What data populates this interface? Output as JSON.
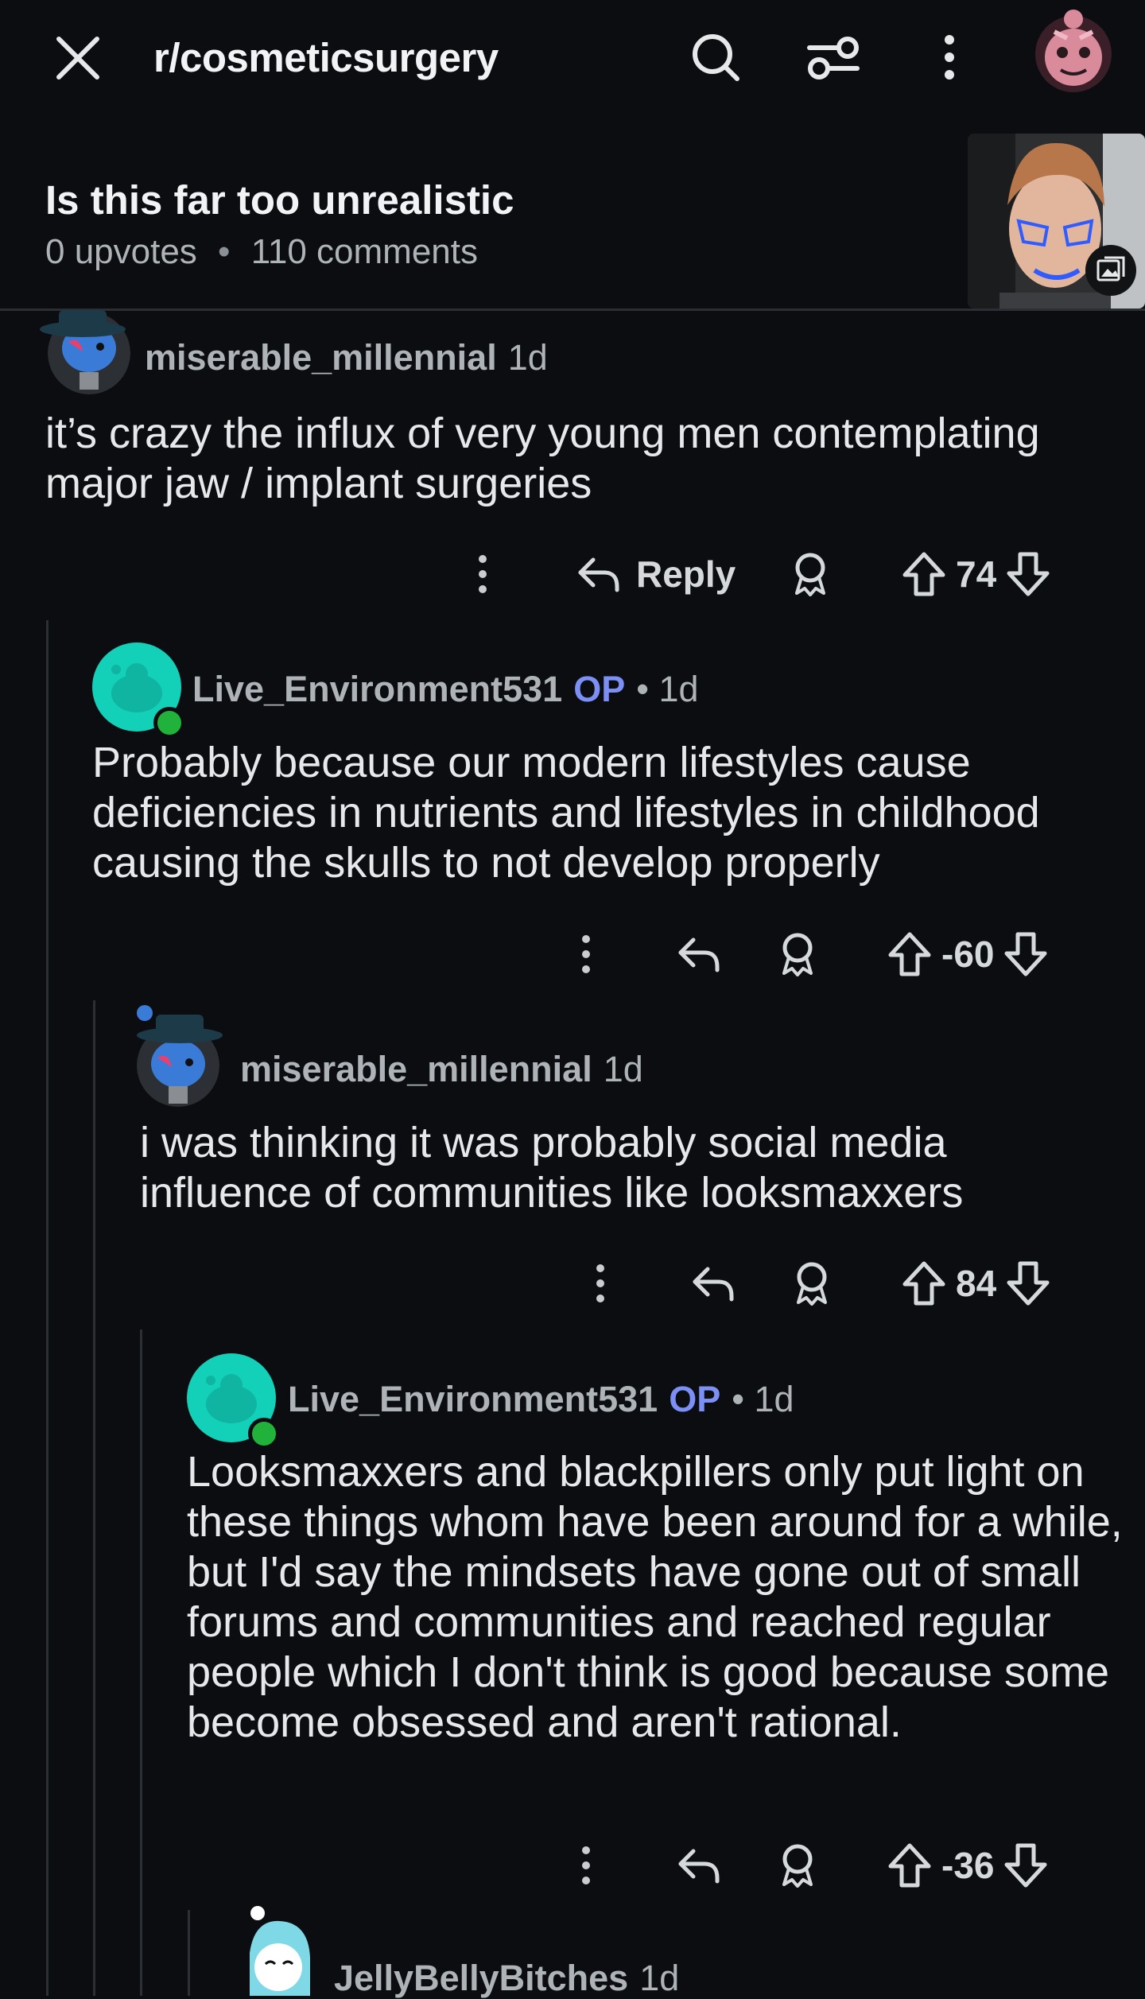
{
  "topbar": {
    "subreddit": "r/cosmeticsurgery"
  },
  "post": {
    "title": "Is this far too unrealistic",
    "upvotes": "0 upvotes",
    "separator": "•",
    "comments": "110 comments"
  },
  "comments": [
    {
      "username": "miserable_millennial",
      "age": "1d",
      "body": "it’s crazy the influx of very young men contemplating major jaw / implant surgeries",
      "reply_label": "Reply",
      "score": "74"
    },
    {
      "username": "Live_Environment531",
      "op": "OP",
      "age": "• 1d",
      "body": "Probably because our modern lifestyles cause deficiencies in nutrients and lifestyles in childhood causing the skulls to not develop properly",
      "score": "-60"
    },
    {
      "username": "miserable_millennial",
      "age": "1d",
      "body": "i was thinking it was probably social media influence of communities like looksmaxxers",
      "score": "84"
    },
    {
      "username": "Live_Environment531",
      "op": "OP",
      "age": "• 1d",
      "body": "Looksmaxxers and blackpillers only put light on these things whom have been around for a while, but I'd say the mindsets have gone out of small forums and communities and reached regular people which I don't think is good because some become obsessed and aren't rational.",
      "score": "-36"
    },
    {
      "username": "JellyBellyBitches",
      "age": "1d"
    }
  ],
  "colors": {
    "background": "#0b0d10",
    "op_tag": "#7c8ff5",
    "online": "#21b23b",
    "avatar_teal": "#12d1b8"
  },
  "icons": [
    "close-icon",
    "search-icon",
    "filter-icon",
    "more-vertical-icon",
    "profile-avatar",
    "image-icon",
    "reply-icon",
    "award-icon",
    "upvote-icon",
    "downvote-icon"
  ]
}
